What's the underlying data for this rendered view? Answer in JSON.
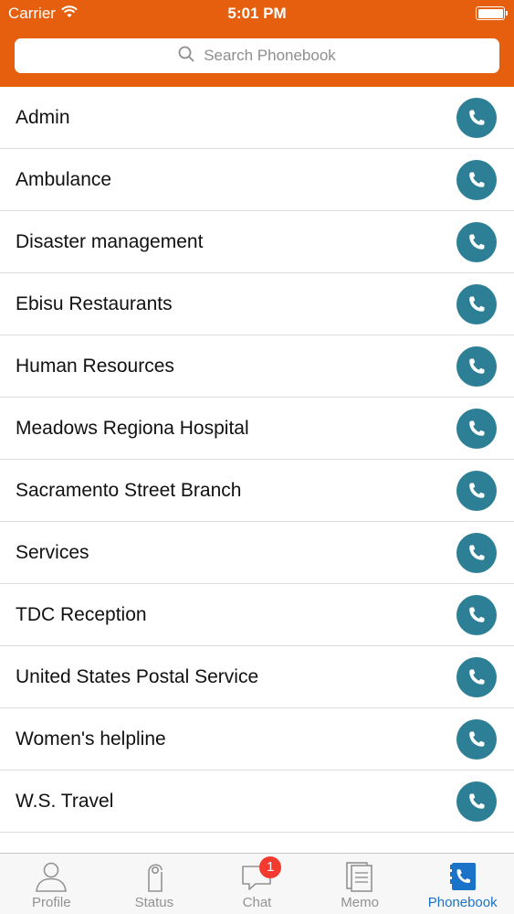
{
  "status_bar": {
    "carrier": "Carrier",
    "time": "5:01 PM",
    "battery_level": 1.0
  },
  "search": {
    "placeholder": "Search Phonebook",
    "icon": "search-icon"
  },
  "contacts": [
    {
      "name": "Admin"
    },
    {
      "name": "Ambulance"
    },
    {
      "name": "Disaster management"
    },
    {
      "name": "Ebisu Restaurants"
    },
    {
      "name": "Human Resources"
    },
    {
      "name": "Meadows Regiona Hospital"
    },
    {
      "name": "Sacramento Street Branch"
    },
    {
      "name": "Services"
    },
    {
      "name": "TDC Reception"
    },
    {
      "name": "United States Postal Service"
    },
    {
      "name": "Women's helpline"
    },
    {
      "name": "W.S. Travel"
    }
  ],
  "call_icon": "phone-icon",
  "tabs": [
    {
      "label": "Profile",
      "icon": "person-icon",
      "active": false
    },
    {
      "label": "Status",
      "icon": "door-hanger-icon",
      "active": false
    },
    {
      "label": "Chat",
      "icon": "chat-bubble-icon",
      "active": false,
      "badge": "1"
    },
    {
      "label": "Memo",
      "icon": "memo-icon",
      "active": false
    },
    {
      "label": "Phonebook",
      "icon": "phonebook-icon",
      "active": true
    }
  ],
  "colors": {
    "header": "#e55f0e",
    "call_button": "#2d7f96",
    "tab_active": "#1a73c8",
    "tab_inactive": "#929292",
    "badge": "#f23a2f"
  }
}
